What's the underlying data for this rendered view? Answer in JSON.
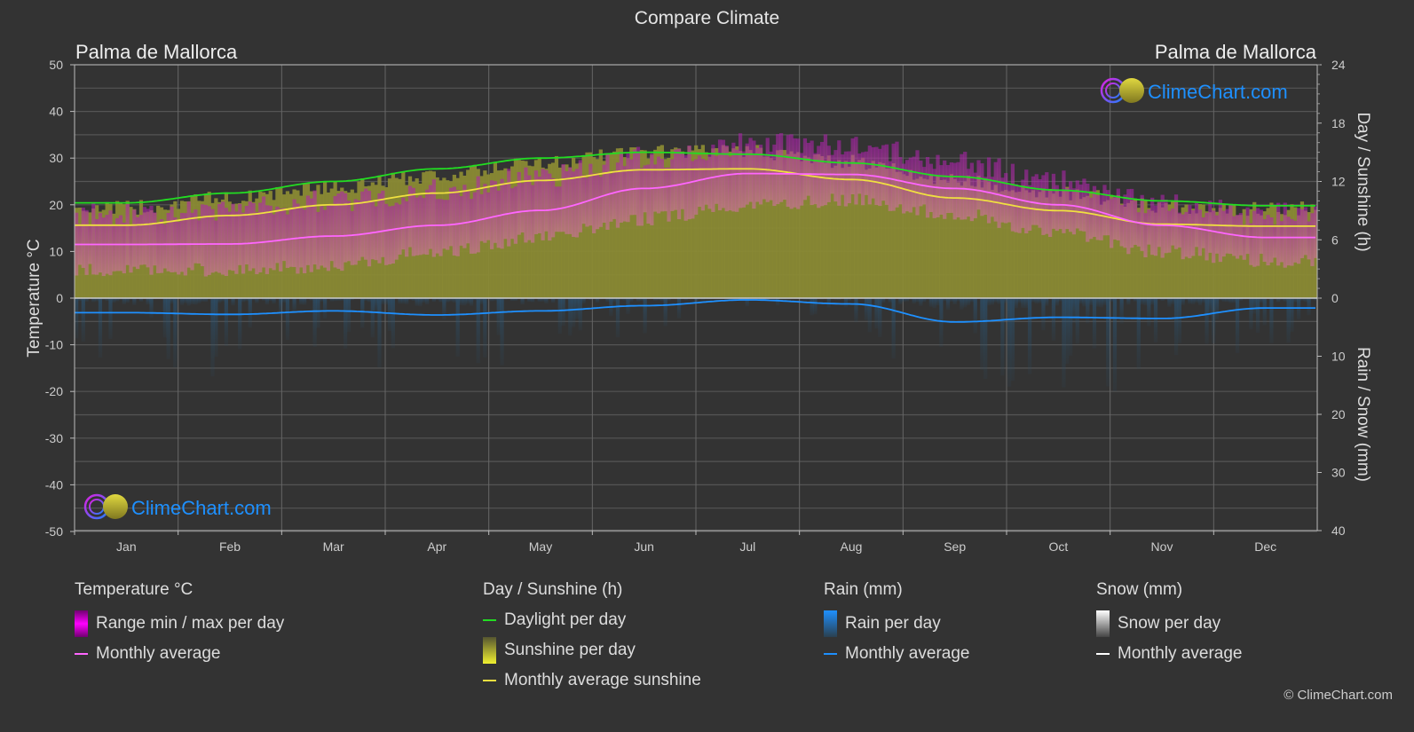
{
  "title": "Compare Climate",
  "location_left": "Palma de Mallorca",
  "location_right": "Palma de Mallorca",
  "logo_text": "ClimeChart.com",
  "copyright": "© ClimeChart.com",
  "colors": {
    "background": "#333333",
    "temp_range": "#e000e0",
    "temp_avg": "#ff66ff",
    "daylight": "#22dd22",
    "sunshine_fill": "#8a8a30",
    "sunshine_avg": "#f0e040",
    "rain": "#1e88e5",
    "rain_avg": "#1e90ff",
    "snow": "#ffffff",
    "grid": "#555555",
    "logo_blue": "#1e90ff"
  },
  "chart_data": {
    "type": "line",
    "title": "Compare Climate",
    "categories": [
      "Jan",
      "Feb",
      "Mar",
      "Apr",
      "May",
      "Jun",
      "Jul",
      "Aug",
      "Sep",
      "Oct",
      "Nov",
      "Dec"
    ],
    "axes": {
      "left": {
        "label": "Temperature °C",
        "range": [
          -50,
          50
        ],
        "ticks": [
          50,
          40,
          30,
          20,
          10,
          0,
          -10,
          -20,
          -30,
          -40,
          -50
        ]
      },
      "right_top": {
        "label": "Day / Sunshine (h)",
        "range": [
          0,
          24
        ],
        "ticks": [
          24,
          18,
          12,
          6,
          0
        ]
      },
      "right_bottom": {
        "label": "Rain / Snow (mm)",
        "range": [
          0,
          40
        ],
        "ticks": [
          0,
          10,
          20,
          30,
          40
        ]
      }
    },
    "grid": true,
    "series": [
      {
        "name": "Temperature monthly average",
        "unit": "°C",
        "axis": "left",
        "values": [
          11.5,
          11.6,
          13.3,
          15.6,
          18.8,
          23.5,
          26.7,
          26.5,
          23.5,
          20.0,
          15.6,
          13.0
        ]
      },
      {
        "name": "Temperature range max (approx.)",
        "unit": "°C",
        "axis": "left",
        "values": [
          17,
          18,
          20,
          22,
          25,
          29,
          32,
          32,
          28,
          24,
          19,
          17
        ]
      },
      {
        "name": "Temperature range min (approx.)",
        "unit": "°C",
        "axis": "left",
        "values": [
          6,
          6,
          7,
          10,
          13,
          17,
          20,
          21,
          18,
          14,
          10,
          8
        ]
      },
      {
        "name": "Daylight per day",
        "unit": "h",
        "axis": "right_top",
        "values": [
          9.8,
          10.8,
          12.0,
          13.3,
          14.4,
          15.0,
          14.8,
          13.9,
          12.5,
          11.1,
          10.0,
          9.5
        ]
      },
      {
        "name": "Monthly average sunshine",
        "unit": "h",
        "axis": "right_top",
        "values": [
          7.5,
          8.5,
          9.6,
          10.8,
          12.1,
          13.2,
          13.3,
          12.2,
          10.3,
          9.0,
          7.6,
          7.4
        ]
      },
      {
        "name": "Rain monthly average",
        "unit": "mm",
        "axis": "right_bottom",
        "values": [
          2.5,
          2.8,
          2.2,
          2.9,
          2.2,
          1.3,
          0.3,
          1.0,
          4.1,
          3.3,
          3.5,
          1.7
        ]
      }
    ]
  },
  "legend": {
    "groups": [
      {
        "title": "Temperature °C",
        "items": [
          {
            "label": "Range min / max per day",
            "kind": "box",
            "color": "#e000e0"
          },
          {
            "label": "Monthly average",
            "kind": "line",
            "color": "#ff66ff"
          }
        ]
      },
      {
        "title": "Day / Sunshine (h)",
        "items": [
          {
            "label": "Daylight per day",
            "kind": "line",
            "color": "#22dd22"
          },
          {
            "label": "Sunshine per day",
            "kind": "box",
            "color": "#e8e830"
          },
          {
            "label": "Monthly average sunshine",
            "kind": "line",
            "color": "#f0e040"
          }
        ]
      },
      {
        "title": "Rain (mm)",
        "items": [
          {
            "label": "Rain per day",
            "kind": "box",
            "color": "#1e88e5"
          },
          {
            "label": "Monthly average",
            "kind": "line",
            "color": "#1e90ff"
          }
        ]
      },
      {
        "title": "Snow (mm)",
        "items": [
          {
            "label": "Snow per day",
            "kind": "box",
            "color": "#dddddd"
          },
          {
            "label": "Monthly average",
            "kind": "line",
            "color": "#ffffff"
          }
        ]
      }
    ]
  }
}
